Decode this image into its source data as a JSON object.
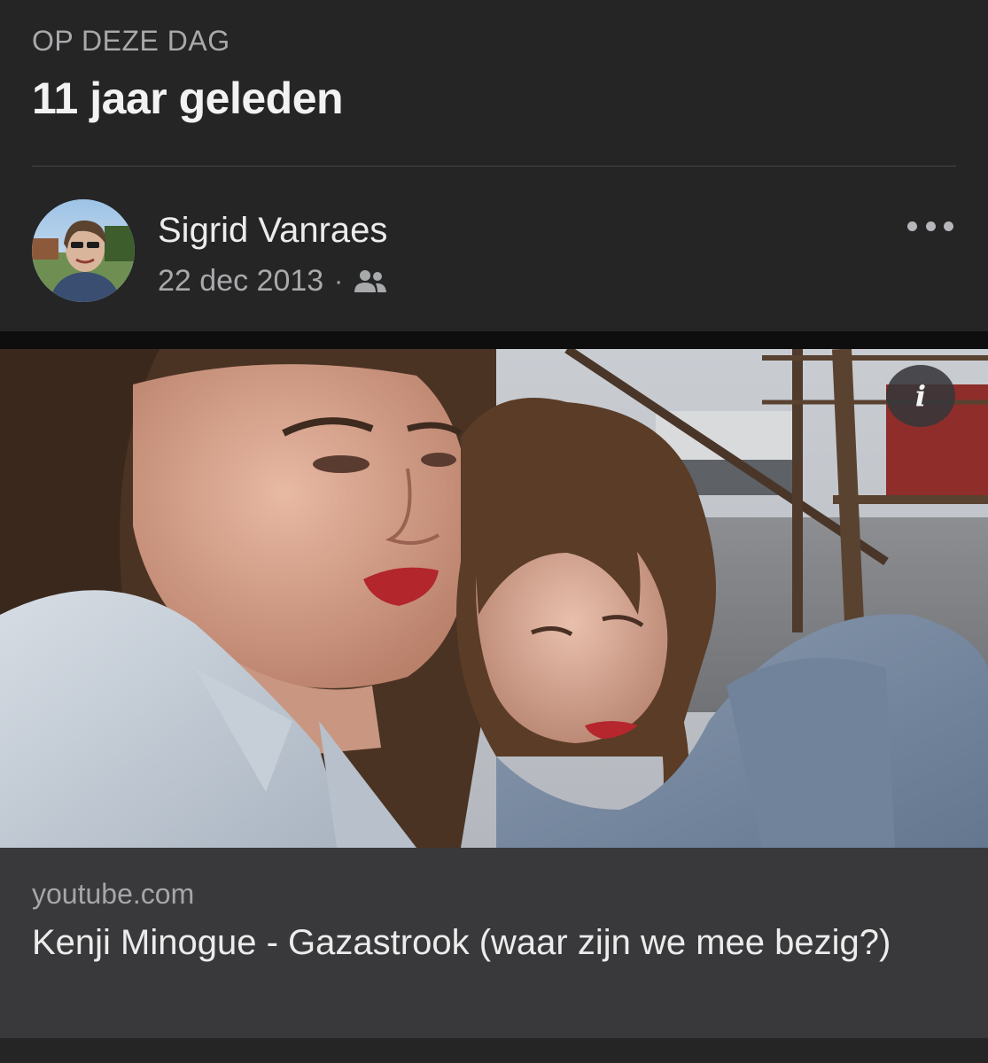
{
  "memory": {
    "kicker": "OP DEZE DAG",
    "title": "11 jaar geleden"
  },
  "post": {
    "author": "Sigrid Vanraes",
    "date": "22 dec 2013",
    "separator": "·",
    "audience_icon": "friends-icon",
    "more_icon": "more-horizontal-icon"
  },
  "media": {
    "description_icon": "info-icon",
    "info_glyph": "i"
  },
  "link": {
    "domain": "youtube.com",
    "title": "Kenji Minogue - Gazastrook (waar zijn we mee bezig?)"
  },
  "colors": {
    "background": "#252526",
    "link_preview": "#39393b",
    "primary_text": "#ececec",
    "secondary_text": "#a8a9ab"
  }
}
